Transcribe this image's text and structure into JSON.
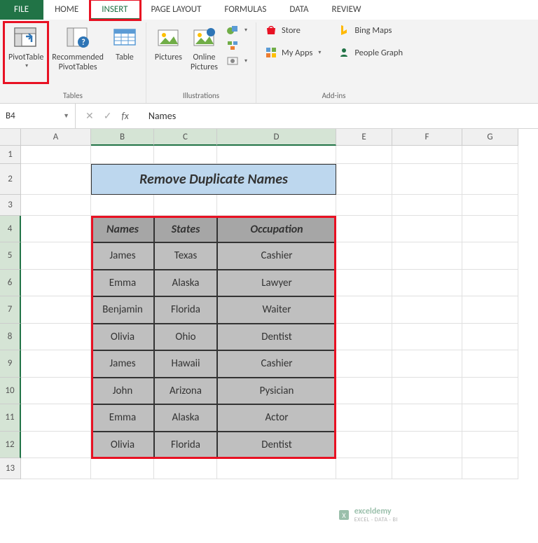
{
  "tabs": {
    "file": "FILE",
    "home": "HOME",
    "insert": "INSERT",
    "page_layout": "PAGE LAYOUT",
    "formulas": "FORMULAS",
    "data": "DATA",
    "review": "REVIEW"
  },
  "ribbon": {
    "tables": {
      "pivot_table": "PivotTable",
      "recommended": "Recommended\nPivotTables",
      "table": "Table",
      "label": "Tables"
    },
    "illustrations": {
      "pictures": "Pictures",
      "online_pictures": "Online\nPictures",
      "label": "Illustrations"
    },
    "addins": {
      "store": "Store",
      "my_apps": "My Apps",
      "bing_maps": "Bing Maps",
      "people_graph": "People Graph",
      "label": "Add-ins"
    }
  },
  "name_box": "B4",
  "formula_value": "Names",
  "columns": [
    "A",
    "B",
    "C",
    "D",
    "E",
    "F",
    "G"
  ],
  "rows": [
    "1",
    "2",
    "3",
    "4",
    "5",
    "6",
    "7",
    "8",
    "9",
    "10",
    "11",
    "12",
    "13"
  ],
  "title": "Remove Duplicate Names",
  "headers": {
    "b": "Names",
    "c": "States",
    "d": "Occupation"
  },
  "data": [
    {
      "b": "James",
      "c": "Texas",
      "d": "Cashier"
    },
    {
      "b": "Emma",
      "c": "Alaska",
      "d": "Lawyer"
    },
    {
      "b": "Benjamin",
      "c": "Florida",
      "d": "Waiter"
    },
    {
      "b": "Olivia",
      "c": "Ohio",
      "d": "Dentist"
    },
    {
      "b": "James",
      "c": "Hawaii",
      "d": "Cashier"
    },
    {
      "b": "John",
      "c": "Arizona",
      "d": "Pysician"
    },
    {
      "b": "Emma",
      "c": "Alaska",
      "d": "Actor"
    },
    {
      "b": "Olivia",
      "c": "Florida",
      "d": "Dentist"
    }
  ],
  "watermark": {
    "brand": "exceldemy",
    "sub": "EXCEL · DATA · BI"
  }
}
